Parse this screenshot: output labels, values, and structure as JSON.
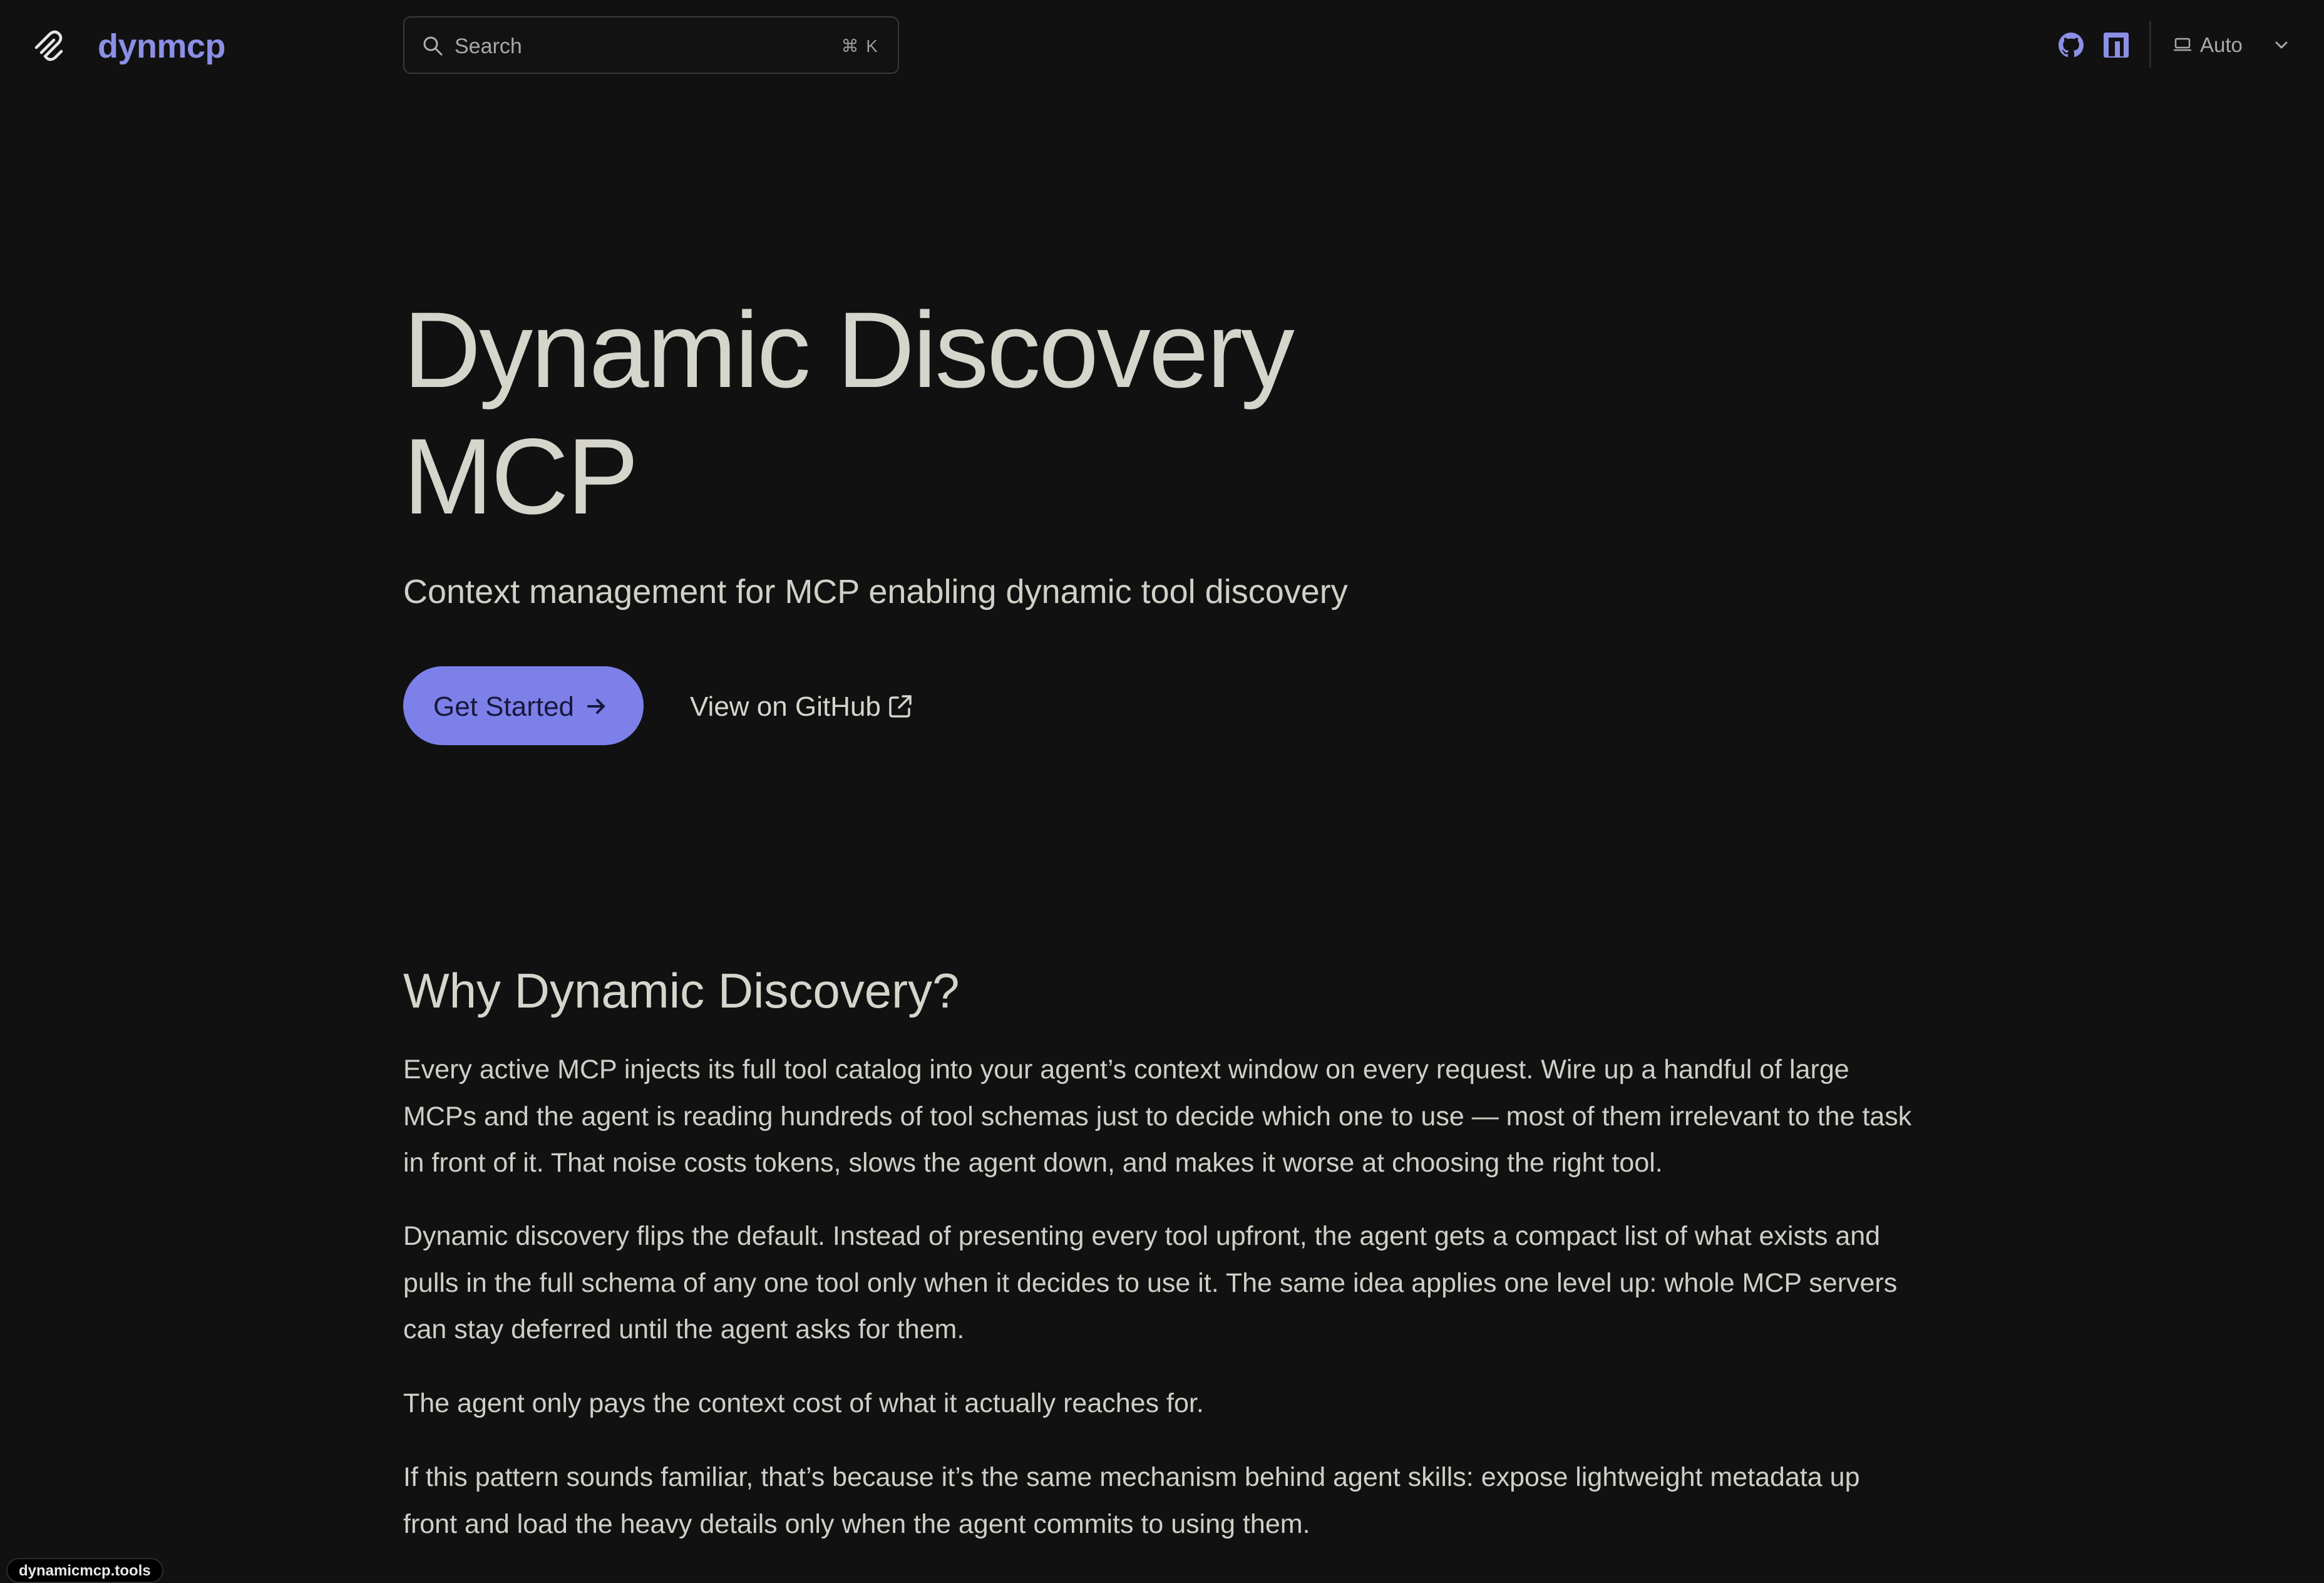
{
  "header": {
    "brand": "dynmcp",
    "search": {
      "placeholder": "Search",
      "shortcut": "⌘ K"
    },
    "icons": [
      "logo-icon",
      "github-icon",
      "npm-icon"
    ],
    "theme": {
      "selected": "Auto",
      "icon": "monitor-icon"
    }
  },
  "hero": {
    "title_line1": "Dynamic Discovery",
    "title_line2": "MCP",
    "subtitle": "Context management for MCP enabling dynamic tool discovery",
    "primary_button": "Get Started",
    "secondary_button": "View on GitHub"
  },
  "section": {
    "heading": "Why Dynamic Discovery?",
    "paragraphs": [
      "Every active MCP injects its full tool catalog into your agent’s context window on every request. Wire up a handful of large MCPs and the agent is reading hundreds of tool schemas just to decide which one to use — most of them irrelevant to the task in front of it. That noise costs tokens, slows the agent down, and makes it worse at choosing the right tool.",
      "Dynamic discovery flips the default. Instead of presenting every tool upfront, the agent gets a compact list of what exists and pulls in the full schema of any one tool only when it decides to use it. The same idea applies one level up: whole MCP servers can stay deferred until the agent asks for them.",
      "The agent only pays the context cost of what it actually reaches for.",
      "If this pattern sounds familiar, that’s because it’s the same mechanism behind agent skills: expose lightweight metadata up front and load the heavy details only when the agent commits to using them."
    ]
  },
  "status_bar": {
    "url": "dynamicmcp.tools"
  },
  "colors": {
    "background": "#111111",
    "accent": "#7d80e8",
    "brand": "#8b8fe6",
    "text": "#d5d5cc"
  }
}
